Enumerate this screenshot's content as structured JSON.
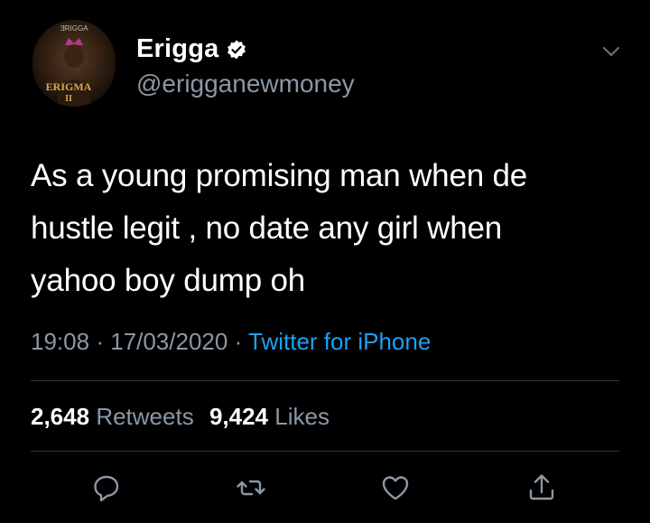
{
  "user": {
    "display_name": "Erigga",
    "handle": "@erigganewmoney",
    "avatar_art": {
      "top_text": "ƎRIGGA",
      "title": "ERIGMA",
      "subtitle": "II"
    }
  },
  "tweet": {
    "text_lines": [
      "As a young promising man when de",
      "hustle legit , no date any girl when",
      "yahoo boy dump oh"
    ],
    "time": "19:08",
    "date": "17/03/2020",
    "source": "Twitter for iPhone"
  },
  "stats": {
    "retweets_count": "2,648",
    "retweets_label": "Retweets",
    "likes_count": "9,424",
    "likes_label": "Likes"
  },
  "actions": [
    "reply-icon",
    "retweet-icon",
    "like-icon",
    "share-icon"
  ],
  "colors": {
    "background": "#000000",
    "text": "#ffffff",
    "muted": "#8b98a5",
    "link": "#1da1f2",
    "divider": "#2f3336"
  }
}
